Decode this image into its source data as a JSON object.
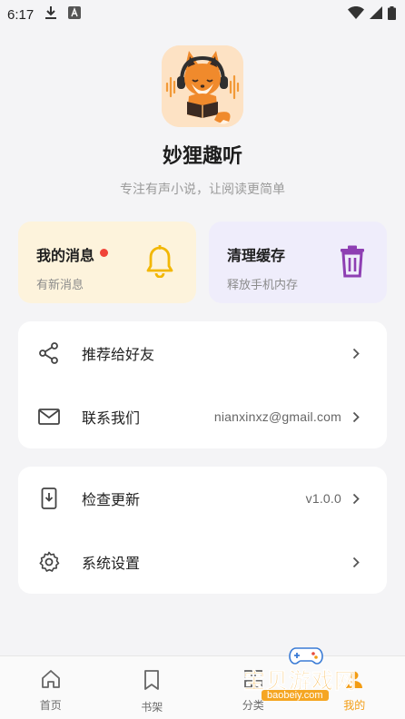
{
  "status_bar": {
    "time": "6:17"
  },
  "app": {
    "name": "妙狸趣听",
    "slogan": "专注有声小说，让阅读更简单"
  },
  "quick_cards": {
    "messages": {
      "title": "我的消息",
      "subtitle": "有新消息",
      "unread": true,
      "accent": "#f2b705"
    },
    "cache": {
      "title": "清理缓存",
      "subtitle": "释放手机内存",
      "accent": "#8e3fb3"
    }
  },
  "menu": {
    "group1": [
      {
        "label": "推荐给好友",
        "value": ""
      },
      {
        "label": "联系我们",
        "value": "nianxinxz@gmail.com"
      }
    ],
    "group2": [
      {
        "label": "检查更新",
        "value": "v1.0.0"
      },
      {
        "label": "系统设置",
        "value": ""
      }
    ]
  },
  "bottom_nav": {
    "items": [
      {
        "label": "首页",
        "icon": "home-icon"
      },
      {
        "label": "书架",
        "icon": "bookmark-icon"
      },
      {
        "label": "分类",
        "icon": "grid-icon"
      },
      {
        "label": "我的",
        "icon": "profile-icon",
        "active": true
      }
    ],
    "active_color": "#f39c12"
  },
  "watermark": {
    "text": "宝贝游戏网",
    "url": "baobeiy.com"
  }
}
